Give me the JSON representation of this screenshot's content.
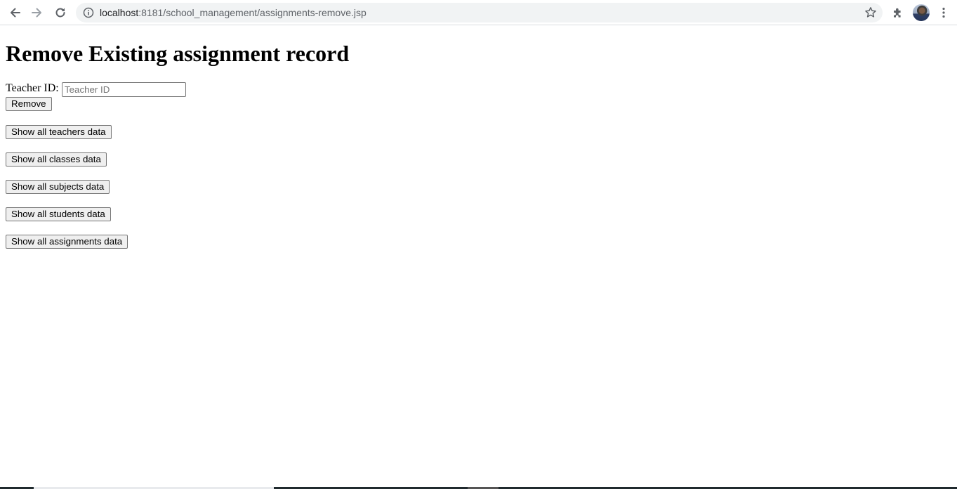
{
  "browser": {
    "url_host": "localhost",
    "url_rest": ":8181/school_management/assignments-remove.jsp",
    "icons": [
      "back-icon",
      "forward-icon",
      "reload-icon",
      "info-icon",
      "star-icon",
      "extensions-icon",
      "avatar",
      "menu-icon"
    ]
  },
  "page": {
    "title": "Remove Existing assignment record",
    "form": {
      "label": "Teacher ID:",
      "input_placeholder": "Teacher ID",
      "input_value": "",
      "submit_label": "Remove"
    },
    "buttons": [
      "Show all teachers data",
      "Show all classes data",
      "Show all subjects data",
      "Show all students data",
      "Show all assignments data"
    ]
  },
  "colors": {
    "omnibox_bg": "#f1f3f4",
    "button_bg": "#efefef",
    "button_border": "#767676"
  }
}
